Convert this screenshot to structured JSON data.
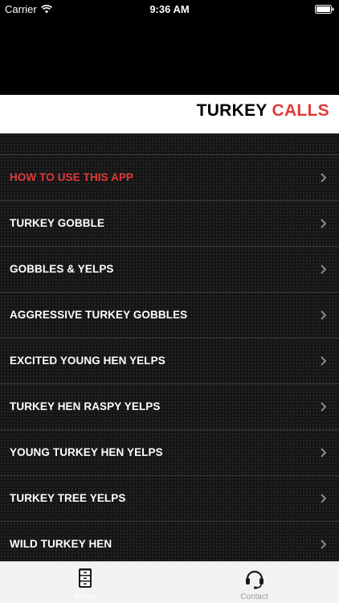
{
  "status_bar": {
    "carrier": "Carrier",
    "time": "9:36 AM"
  },
  "header": {
    "title_part1": "TURKEY",
    "title_part2": "CALLS"
  },
  "colors": {
    "accent": "#e03a3a",
    "background": "#000000",
    "tab_bar": "#f2f2f2"
  },
  "menu": {
    "items": [
      {
        "label": "HOW TO USE THIS APP"
      },
      {
        "label": "TURKEY GOBBLE"
      },
      {
        "label": "GOBBLES & YELPS"
      },
      {
        "label": "AGGRESSIVE TURKEY GOBBLES"
      },
      {
        "label": "EXCITED YOUNG HEN YELPS"
      },
      {
        "label": "TURKEY HEN RASPY YELPS"
      },
      {
        "label": "YOUNG TURKEY HEN YELPS"
      },
      {
        "label": "TURKEY TREE YELPS"
      },
      {
        "label": "WILD TURKEY HEN"
      }
    ]
  },
  "tab_bar": {
    "menu_label": "Menu",
    "contact_label": "Contact"
  },
  "icons": {
    "menu_tab": "filing-cabinet-icon",
    "contact_tab": "headset-icon",
    "chevron": "chevron-right-icon"
  }
}
